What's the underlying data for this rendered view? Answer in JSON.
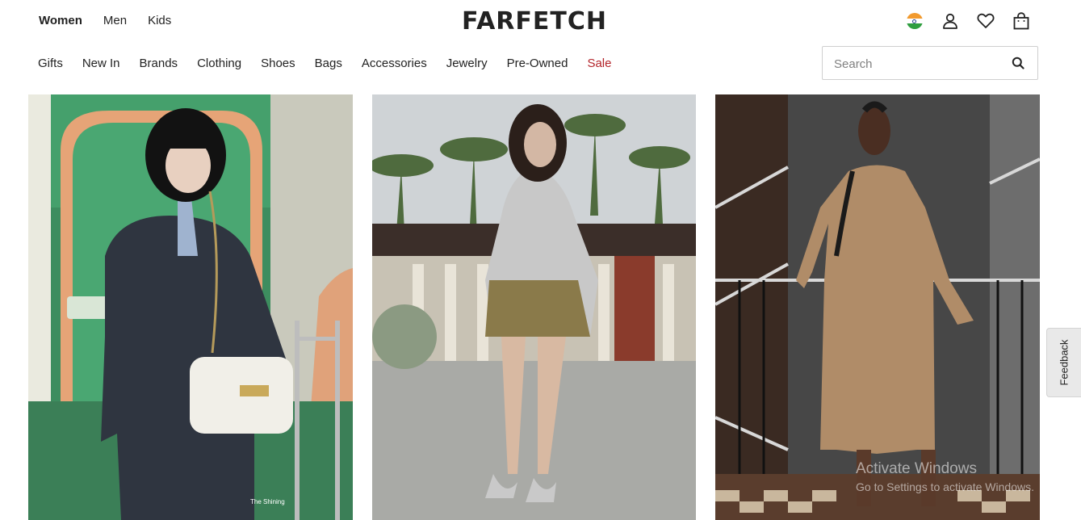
{
  "header": {
    "gender_tabs": [
      {
        "label": "Women",
        "active": true
      },
      {
        "label": "Men",
        "active": false
      },
      {
        "label": "Kids",
        "active": false
      }
    ],
    "logo": "FARFETCH",
    "icons": [
      "india-flag-icon",
      "account-icon",
      "wishlist-heart-icon",
      "shopping-bag-icon"
    ]
  },
  "nav": {
    "categories": [
      "Gifts",
      "New In",
      "Brands",
      "Clothing",
      "Shoes",
      "Bags",
      "Accessories",
      "Jewelry",
      "Pre-Owned",
      "Sale"
    ],
    "sale_color": "#b3242a"
  },
  "search": {
    "placeholder": "Search",
    "value": ""
  },
  "tiles": [
    {
      "caption": "The Shining"
    },
    {
      "caption": ""
    },
    {
      "caption": ""
    }
  ],
  "feedback": {
    "label": "Feedback"
  },
  "watermark": {
    "title": "Activate Windows",
    "subtitle": "Go to Settings to activate Windows."
  }
}
